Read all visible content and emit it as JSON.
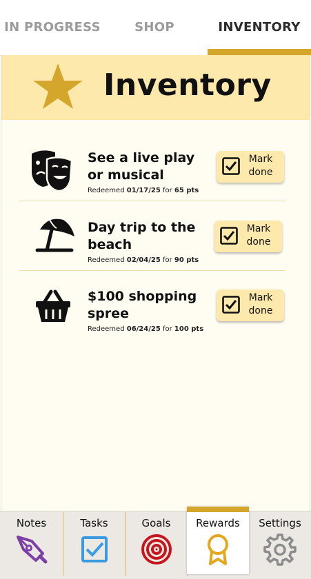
{
  "top_tabs": [
    {
      "label": "IN PROGRESS",
      "active": false
    },
    {
      "label": "SHOP",
      "active": false
    },
    {
      "label": "INVENTORY",
      "active": true
    }
  ],
  "header": {
    "title": "Inventory",
    "icon": "star-icon"
  },
  "items": [
    {
      "name": "See a live play or musical",
      "redeemed_label": "Redeemed",
      "date": "01/17/25",
      "for_label": "for",
      "points": "65 pts",
      "icon": "theater-masks-icon",
      "button_label": "Mark done"
    },
    {
      "name": "Day trip to the beach",
      "redeemed_label": "Redeemed",
      "date": "02/04/25",
      "for_label": "for",
      "points": "90 pts",
      "icon": "beach-umbrella-icon",
      "button_label": "Mark done"
    },
    {
      "name": "$100 shopping spree",
      "redeemed_label": "Redeemed",
      "date": "06/24/25",
      "for_label": "for",
      "points": "100 pts",
      "icon": "shopping-basket-icon",
      "button_label": "Mark done"
    }
  ],
  "bottom_nav": [
    {
      "label": "Notes",
      "icon": "pen-nib-icon",
      "active": false
    },
    {
      "label": "Tasks",
      "icon": "checkbox-icon",
      "active": false
    },
    {
      "label": "Goals",
      "icon": "target-icon",
      "active": false
    },
    {
      "label": "Rewards",
      "icon": "award-ribbon-icon",
      "active": true
    },
    {
      "label": "Settings",
      "icon": "gear-icon",
      "active": false
    }
  ],
  "colors": {
    "accent": "#d4a72c",
    "header_bg": "#fee9ad",
    "panel_bg": "#fffcf2",
    "notes": "#7b3fa6",
    "tasks": "#3a9be0",
    "goals": "#c4161c",
    "rewards": "#e2a81e",
    "settings": "#8c8c8c"
  }
}
